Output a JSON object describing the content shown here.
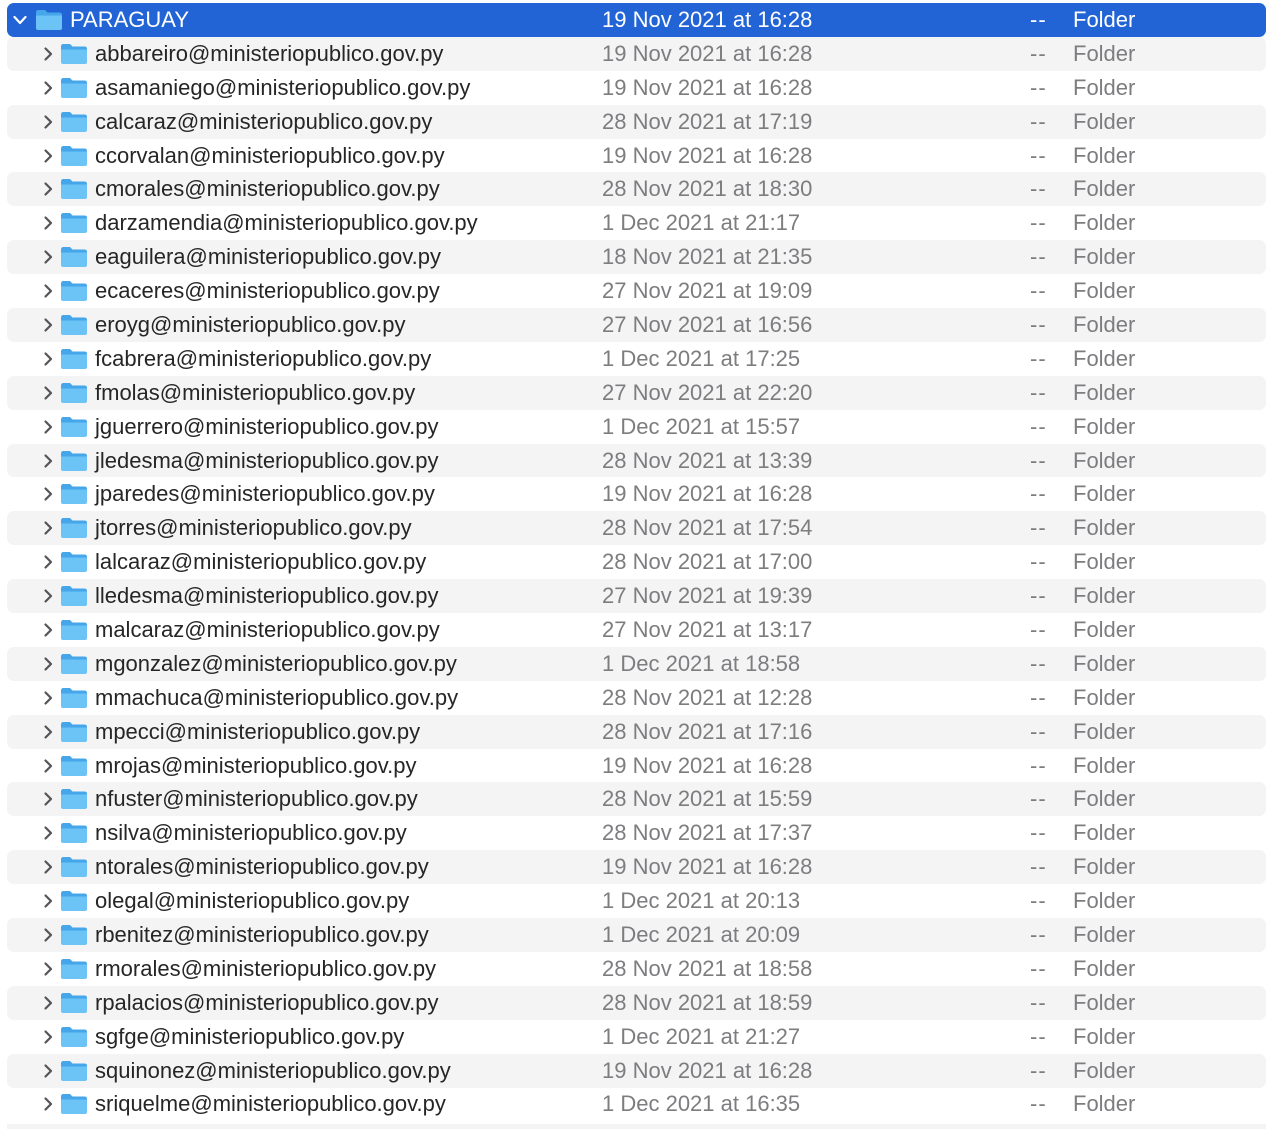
{
  "colors": {
    "selection": "#2264d6",
    "alt_row": "#f4f4f5",
    "folder_front": "#6cc3f5",
    "folder_back": "#45a6ea",
    "name_text": "#262626",
    "secondary_text": "#7d7d80"
  },
  "parent": {
    "name": "PARAGUAY",
    "date": "19 Nov 2021 at 16:28",
    "size": "--",
    "kind": "Folder",
    "expanded": true,
    "selected": true
  },
  "rows": [
    {
      "name": "abbareiro@ministeriopublico.gov.py",
      "date": "19 Nov 2021 at 16:28",
      "size": "--",
      "kind": "Folder"
    },
    {
      "name": "asamaniego@ministeriopublico.gov.py",
      "date": "19 Nov 2021 at 16:28",
      "size": "--",
      "kind": "Folder"
    },
    {
      "name": "calcaraz@ministeriopublico.gov.py",
      "date": "28 Nov 2021 at 17:19",
      "size": "--",
      "kind": "Folder"
    },
    {
      "name": "ccorvalan@ministeriopublico.gov.py",
      "date": "19 Nov 2021 at 16:28",
      "size": "--",
      "kind": "Folder"
    },
    {
      "name": "cmorales@ministeriopublico.gov.py",
      "date": "28 Nov 2021 at 18:30",
      "size": "--",
      "kind": "Folder"
    },
    {
      "name": "darzamendia@ministeriopublico.gov.py",
      "date": "1 Dec 2021 at 21:17",
      "size": "--",
      "kind": "Folder"
    },
    {
      "name": "eaguilera@ministeriopublico.gov.py",
      "date": "18 Nov 2021 at 21:35",
      "size": "--",
      "kind": "Folder"
    },
    {
      "name": "ecaceres@ministeriopublico.gov.py",
      "date": "27 Nov 2021 at 19:09",
      "size": "--",
      "kind": "Folder"
    },
    {
      "name": "eroyg@ministeriopublico.gov.py",
      "date": "27 Nov 2021 at 16:56",
      "size": "--",
      "kind": "Folder"
    },
    {
      "name": "fcabrera@ministeriopublico.gov.py",
      "date": "1 Dec 2021 at 17:25",
      "size": "--",
      "kind": "Folder"
    },
    {
      "name": "fmolas@ministeriopublico.gov.py",
      "date": "27 Nov 2021 at 22:20",
      "size": "--",
      "kind": "Folder"
    },
    {
      "name": "jguerrero@ministeriopublico.gov.py",
      "date": "1 Dec 2021 at 15:57",
      "size": "--",
      "kind": "Folder"
    },
    {
      "name": "jledesma@ministeriopublico.gov.py",
      "date": "28 Nov 2021 at 13:39",
      "size": "--",
      "kind": "Folder"
    },
    {
      "name": "jparedes@ministeriopublico.gov.py",
      "date": "19 Nov 2021 at 16:28",
      "size": "--",
      "kind": "Folder"
    },
    {
      "name": "jtorres@ministeriopublico.gov.py",
      "date": "28 Nov 2021 at 17:54",
      "size": "--",
      "kind": "Folder"
    },
    {
      "name": "lalcaraz@ministeriopublico.gov.py",
      "date": "28 Nov 2021 at 17:00",
      "size": "--",
      "kind": "Folder"
    },
    {
      "name": "lledesma@ministeriopublico.gov.py",
      "date": "27 Nov 2021 at 19:39",
      "size": "--",
      "kind": "Folder"
    },
    {
      "name": "malcaraz@ministeriopublico.gov.py",
      "date": "27 Nov 2021 at 13:17",
      "size": "--",
      "kind": "Folder"
    },
    {
      "name": "mgonzalez@ministeriopublico.gov.py",
      "date": "1 Dec 2021 at 18:58",
      "size": "--",
      "kind": "Folder"
    },
    {
      "name": "mmachuca@ministeriopublico.gov.py",
      "date": "28 Nov 2021 at 12:28",
      "size": "--",
      "kind": "Folder"
    },
    {
      "name": "mpecci@ministeriopublico.gov.py",
      "date": "28 Nov 2021 at 17:16",
      "size": "--",
      "kind": "Folder"
    },
    {
      "name": "mrojas@ministeriopublico.gov.py",
      "date": "19 Nov 2021 at 16:28",
      "size": "--",
      "kind": "Folder"
    },
    {
      "name": "nfuster@ministeriopublico.gov.py",
      "date": "28 Nov 2021 at 15:59",
      "size": "--",
      "kind": "Folder"
    },
    {
      "name": "nsilva@ministeriopublico.gov.py",
      "date": "28 Nov 2021 at 17:37",
      "size": "--",
      "kind": "Folder"
    },
    {
      "name": "ntorales@ministeriopublico.gov.py",
      "date": "19 Nov 2021 at 16:28",
      "size": "--",
      "kind": "Folder"
    },
    {
      "name": "olegal@ministeriopublico.gov.py",
      "date": "1 Dec 2021 at 20:13",
      "size": "--",
      "kind": "Folder"
    },
    {
      "name": "rbenitez@ministeriopublico.gov.py",
      "date": "1 Dec 2021 at 20:09",
      "size": "--",
      "kind": "Folder"
    },
    {
      "name": "rmorales@ministeriopublico.gov.py",
      "date": "28 Nov 2021 at 18:58",
      "size": "--",
      "kind": "Folder"
    },
    {
      "name": "rpalacios@ministeriopublico.gov.py",
      "date": "28 Nov 2021 at 18:59",
      "size": "--",
      "kind": "Folder"
    },
    {
      "name": "sgfge@ministeriopublico.gov.py",
      "date": "1 Dec 2021 at 21:27",
      "size": "--",
      "kind": "Folder"
    },
    {
      "name": "squinonez@ministeriopublico.gov.py",
      "date": "19 Nov 2021 at 16:28",
      "size": "--",
      "kind": "Folder"
    },
    {
      "name": "sriquelme@ministeriopublico.gov.py",
      "date": "1 Dec 2021 at 16:35",
      "size": "--",
      "kind": "Folder"
    }
  ]
}
